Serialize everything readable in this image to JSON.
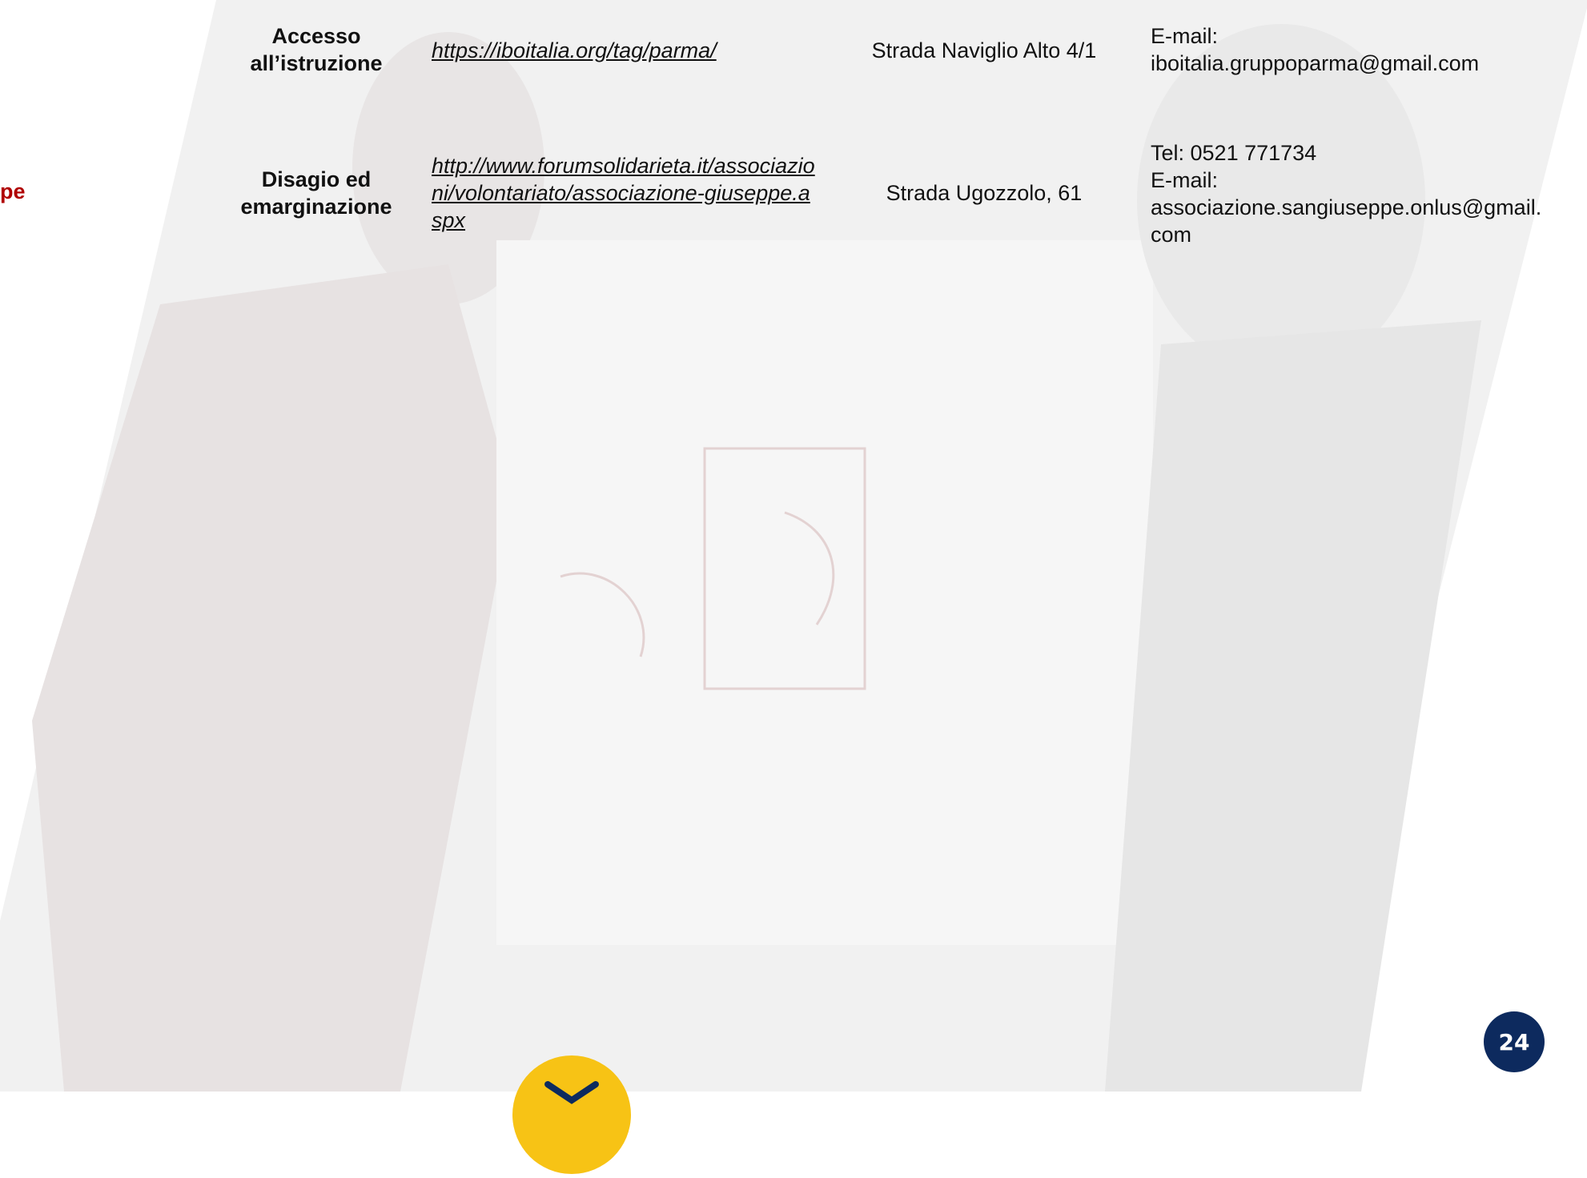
{
  "page": {
    "partial_heading": "pe",
    "page_number": "24"
  },
  "table": {
    "rows": [
      {
        "category": "Accesso all’istruzione",
        "link": " https://iboitalia.org/tag/parma/",
        "address": "Strada Naviglio Alto 4/1",
        "contact_lines": [
          "E-mail:",
          "iboitalia.gruppoparma@gmail.com"
        ]
      },
      {
        "category": "Disagio ed emarginazione",
        "link": "http://www.forumsolidarieta.it/associazioni/volontariato/associazione-giuseppe.aspx",
        "address": "Strada Ugozzolo, 61",
        "contact_lines": [
          "Tel: 0521 771734",
          "E-mail:",
          "associazione.sangiuseppe.onlus@gmail.com"
        ]
      }
    ]
  },
  "colors": {
    "accent_red": "#b00000",
    "badge_blue": "#0d2a5e",
    "logo_yellow": "#f7c315"
  }
}
